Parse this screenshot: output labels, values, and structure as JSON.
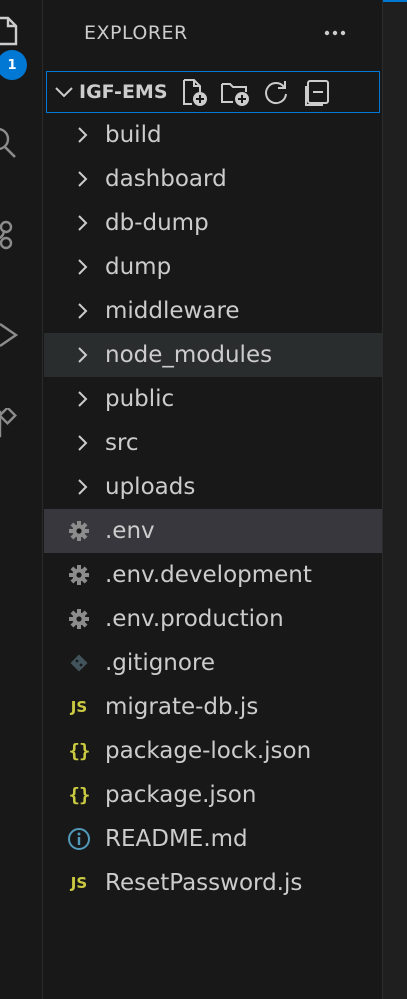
{
  "activity_bar": {
    "badge_count": "1",
    "icons": [
      "explorer-icon",
      "search-icon",
      "source-control-icon",
      "run-debug-icon",
      "extensions-icon"
    ]
  },
  "explorer": {
    "title": "EXPLORER",
    "more_label": "···",
    "folder": {
      "name": "IGF-EMS",
      "actions": [
        "new-file-icon",
        "new-folder-icon",
        "refresh-icon",
        "collapse-all-icon"
      ]
    },
    "items": [
      {
        "label": "build",
        "type": "folder"
      },
      {
        "label": "dashboard",
        "type": "folder"
      },
      {
        "label": "db-dump",
        "type": "folder"
      },
      {
        "label": "dump",
        "type": "folder"
      },
      {
        "label": "middleware",
        "type": "folder"
      },
      {
        "label": "node_modules",
        "type": "folder"
      },
      {
        "label": "public",
        "type": "folder"
      },
      {
        "label": "src",
        "type": "folder"
      },
      {
        "label": "uploads",
        "type": "folder"
      },
      {
        "label": ".env",
        "type": "gear-icon"
      },
      {
        "label": ".env.development",
        "type": "gear-icon"
      },
      {
        "label": ".env.production",
        "type": "gear-icon"
      },
      {
        "label": ".gitignore",
        "type": "git-icon"
      },
      {
        "label": "migrate-db.js",
        "type": "js-icon",
        "icon_text": "JS"
      },
      {
        "label": "package-lock.json",
        "type": "json-icon",
        "icon_text": "{}"
      },
      {
        "label": "package.json",
        "type": "json-icon",
        "icon_text": "{}"
      },
      {
        "label": "README.md",
        "type": "info-icon"
      },
      {
        "label": "ResetPassword.js",
        "type": "js-icon",
        "icon_text": "JS"
      }
    ]
  },
  "colors": {
    "background": "#181818",
    "text": "#cccccc",
    "accent": "#0078d4",
    "hover": "#2a2d2e",
    "selected": "#37373d",
    "js_yellow": "#cbcb41",
    "info_blue": "#519aba",
    "gear_gray": "#8c8c8c"
  }
}
